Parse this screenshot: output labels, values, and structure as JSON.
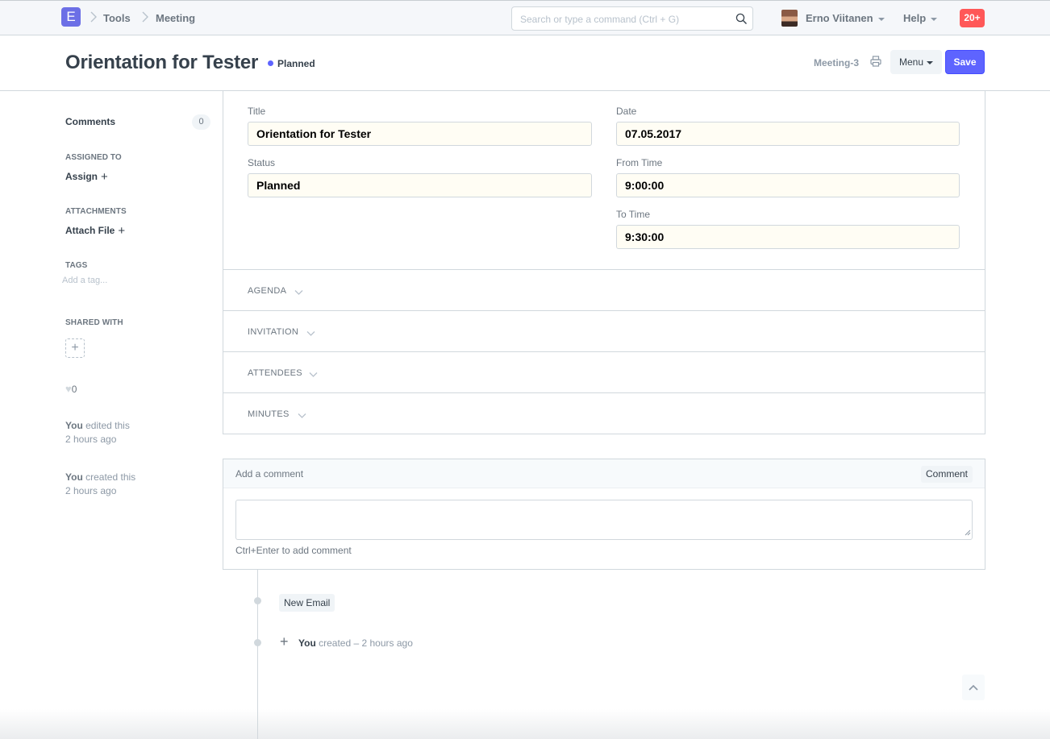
{
  "navbar": {
    "logo_letter": "E",
    "breadcrumbs": [
      "Tools",
      "Meeting"
    ],
    "search_placeholder": "Search or type a command (Ctrl + G)",
    "user_name": "Erno Viitanen",
    "help_label": "Help",
    "notifications": "20+"
  },
  "header": {
    "title": "Orientation for Tester",
    "status": "Planned",
    "doc_name": "Meeting-3",
    "menu_label": "Menu",
    "save_label": "Save"
  },
  "sidebar": {
    "comments_label": "Comments",
    "comments_count": "0",
    "assigned_to_label": "ASSIGNED TO",
    "assign_label": "Assign",
    "attachments_label": "ATTACHMENTS",
    "attach_label": "Attach File",
    "tags_label": "TAGS",
    "tag_placeholder": "Add a tag...",
    "shared_with_label": "SHARED WITH",
    "likes": "0",
    "activity": [
      {
        "who": "You",
        "what": "edited this",
        "when": "2 hours ago"
      },
      {
        "who": "You",
        "what": "created this",
        "when": "2 hours ago"
      }
    ]
  },
  "form": {
    "title_label": "Title",
    "title_value": "Orientation for Tester",
    "status_label": "Status",
    "status_value": "Planned",
    "date_label": "Date",
    "date_value": "07.05.2017",
    "from_time_label": "From Time",
    "from_time_value": "9:00:00",
    "to_time_label": "To Time",
    "to_time_value": "9:30:00",
    "sections": [
      "AGENDA",
      "INVITATION",
      "ATTENDEES",
      "MINUTES"
    ]
  },
  "comment": {
    "header_label": "Add a comment",
    "button_label": "Comment",
    "help_text": "Ctrl+Enter to add comment"
  },
  "timeline": {
    "new_email_label": "New Email",
    "created_who": "You",
    "created_text": "created – 2 hours ago"
  }
}
